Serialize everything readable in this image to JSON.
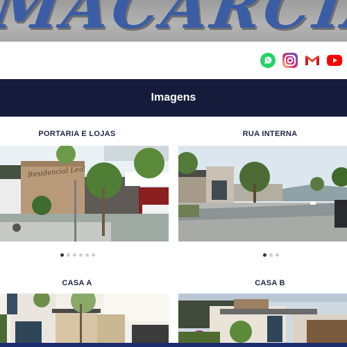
{
  "brand": {
    "logo_text": "MACARCIA"
  },
  "social": {
    "items": [
      {
        "name": "whatsapp",
        "icon": "whatsapp-icon",
        "color": "#25d366"
      },
      {
        "name": "instagram",
        "icon": "instagram-icon",
        "color": "#d6249f"
      },
      {
        "name": "gmail",
        "icon": "gmail-icon",
        "color": "#ea4335"
      },
      {
        "name": "youtube",
        "icon": "youtube-icon",
        "color": "#ff0000"
      }
    ]
  },
  "section": {
    "title": "Imagens"
  },
  "gallery": {
    "portaria": {
      "title": "PORTARIA E LOJAS",
      "sign_text": "Residencial Leal",
      "slides": 6,
      "active": 0
    },
    "rua": {
      "title": "RUA INTERNA",
      "slides": 3,
      "active": 0
    },
    "casa_a": {
      "title": "CASA A"
    },
    "casa_b": {
      "title": "CASA B"
    }
  },
  "colors": {
    "band": "#151c3b",
    "logo": "#3b5da6",
    "title": "#1f2547"
  }
}
